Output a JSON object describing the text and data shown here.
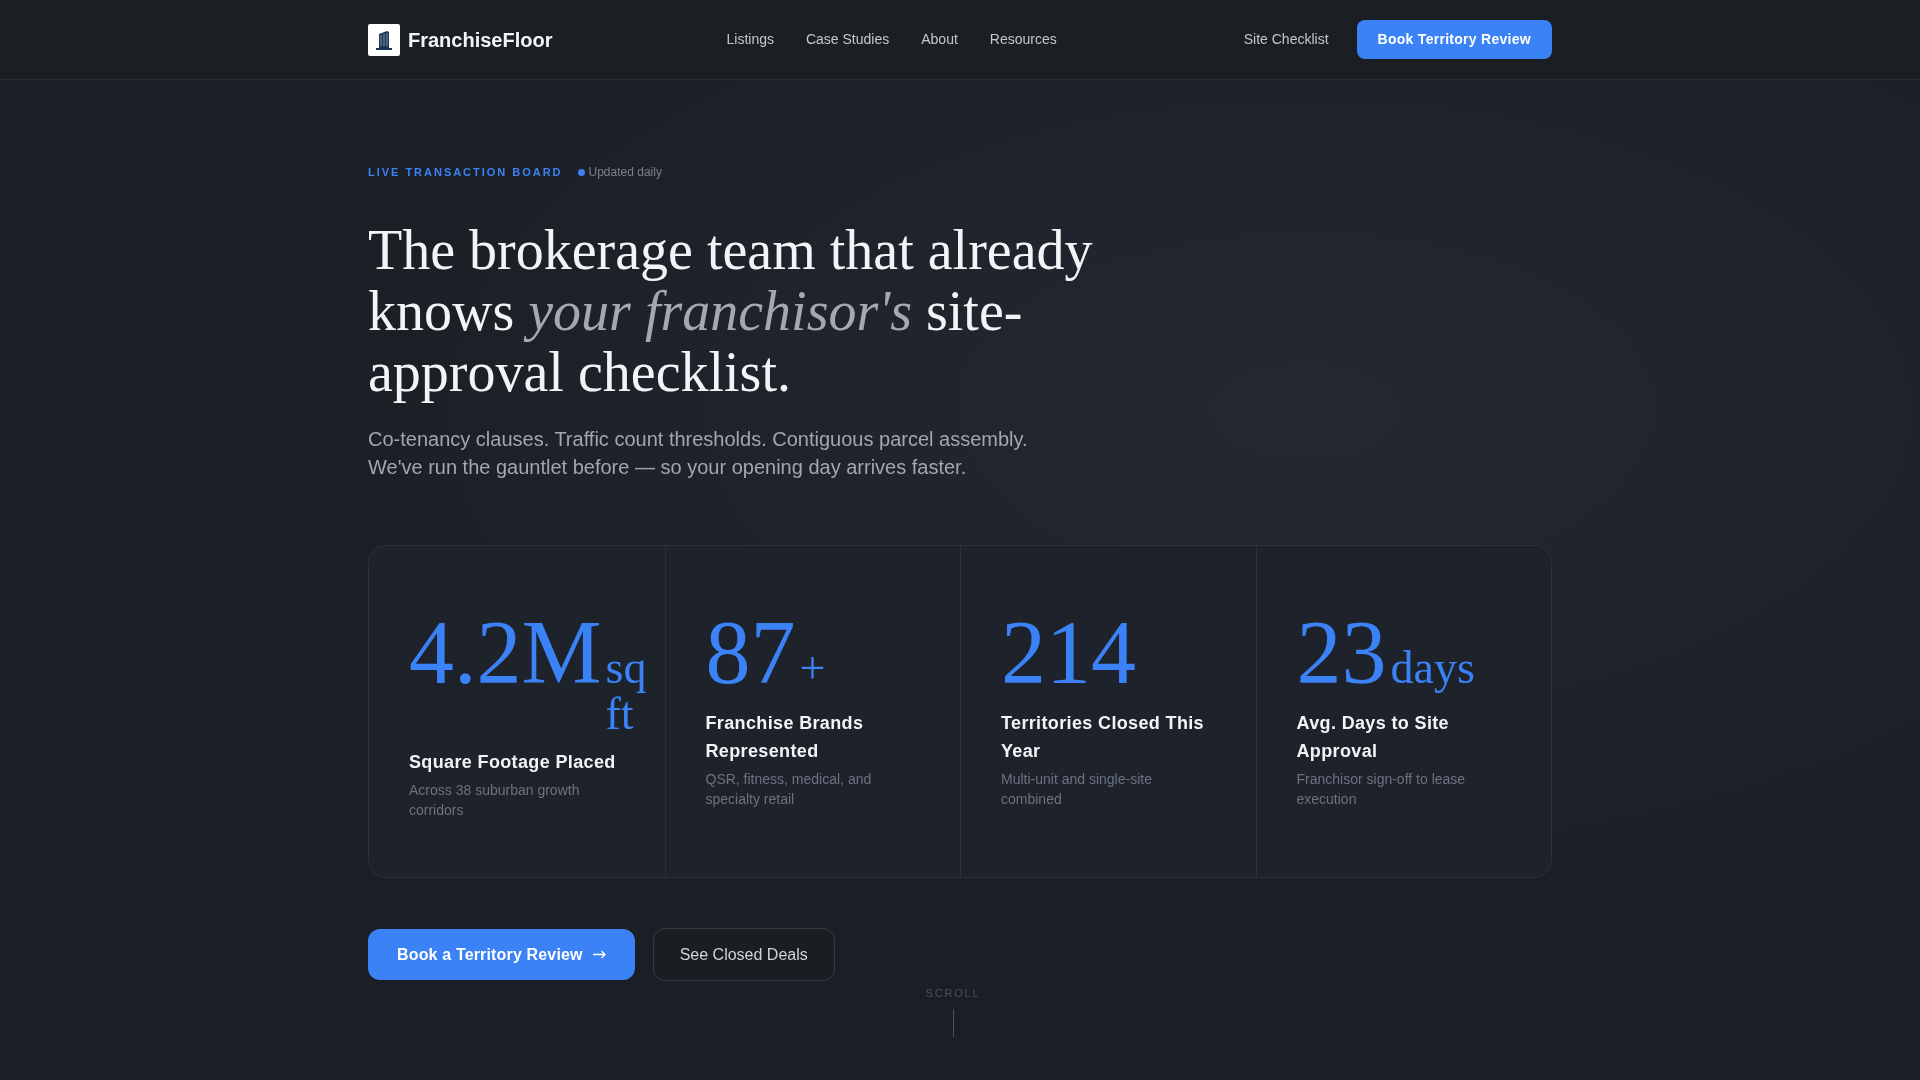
{
  "header": {
    "brand": "FranchiseFloor",
    "nav": [
      "Listings",
      "Case Studies",
      "About",
      "Resources"
    ],
    "secondary_link": "Site Checklist",
    "cta": "Book Territory Review"
  },
  "hero": {
    "eyebrow": "LIVE TRANSACTION BOARD",
    "status": "Updated daily",
    "headline": "The brokerage team that already knows *your franchisor's* site-approval checklist.",
    "subheading": "Co-tenancy clauses. Traffic count thresholds. Contiguous parcel assembly. We've run the gauntlet before — so your opening day arrives faster.",
    "stats": [
      {
        "value": "4.2M",
        "unit": "sq ft",
        "label": "Square Footage Placed",
        "description": "Across 38 suburban growth corridors"
      },
      {
        "value": "87",
        "unit": "+",
        "label": "Franchise Brands Represented",
        "description": "QSR, fitness, medical, and specialty retail"
      },
      {
        "value": "214",
        "label": "Territories Closed This Year",
        "description": "Multi-unit and single-site combined"
      },
      {
        "value": "23",
        "unit": "days",
        "label": "Avg. Days to Site Approval",
        "description": "Franchisor sign-off to lease execution"
      }
    ],
    "actions": [
      {
        "kind": "primary",
        "label": "Book a Territory Review"
      },
      {
        "kind": "secondary",
        "label": "See Closed Deals"
      }
    ],
    "scroll_hint": "SCROLL"
  }
}
